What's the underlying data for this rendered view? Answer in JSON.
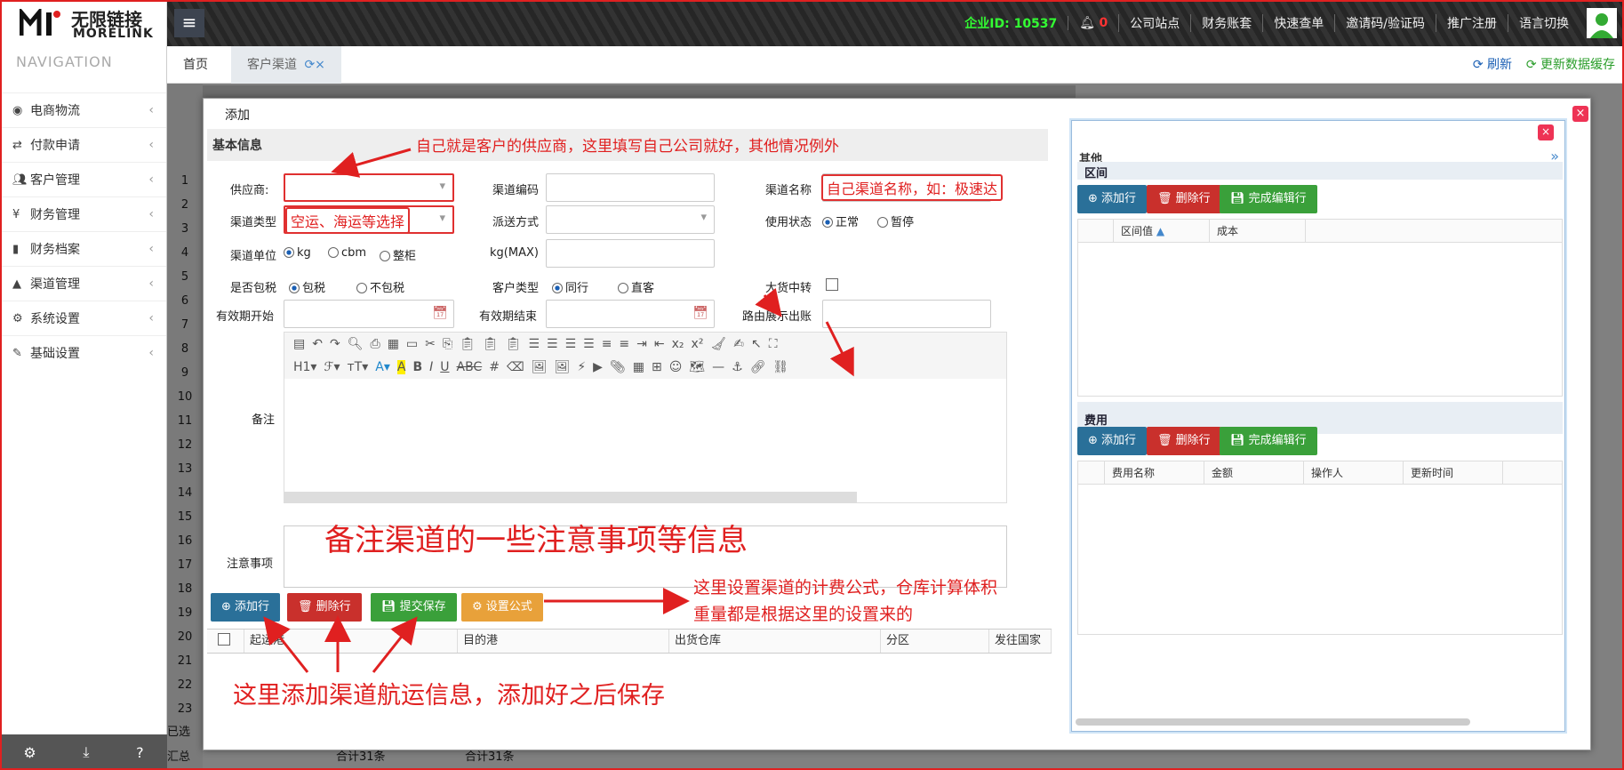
{
  "brand": {
    "name_cn": "无限链接",
    "name_en": "MORELINK"
  },
  "topnav": {
    "company_id_label": "企业ID:",
    "company_id": "10537",
    "notifications": "0",
    "items": [
      "公司站点",
      "财务账套",
      "快速查单",
      "邀请码/验证码",
      "推广注册",
      "语言切换"
    ]
  },
  "sidebar": {
    "title": "NAVIGATION",
    "items": [
      {
        "label": "电商物流",
        "icon": "globe-icon"
      },
      {
        "label": "付款申请",
        "icon": "transfer-icon"
      },
      {
        "label": "客户管理",
        "icon": "users-icon"
      },
      {
        "label": "财务管理",
        "icon": "yen-icon"
      },
      {
        "label": "财务档案",
        "icon": "book-icon"
      },
      {
        "label": "渠道管理",
        "icon": "road-icon"
      },
      {
        "label": "系统设置",
        "icon": "gear-icon"
      },
      {
        "label": "基础设置",
        "icon": "edit-icon"
      }
    ]
  },
  "tabs": {
    "home": "首页",
    "customer_channel": "客户渠道"
  },
  "toolbar_right": {
    "refresh": "刷新",
    "update_cache": "更新数据缓存"
  },
  "background_rows": [
    "1",
    "2",
    "3",
    "4",
    "5",
    "6",
    "7",
    "8",
    "9",
    "10",
    "11",
    "12",
    "13",
    "14",
    "15",
    "16",
    "17",
    "18",
    "19",
    "20",
    "21",
    "22",
    "23"
  ],
  "background_footer": {
    "selected": "已选",
    "summary": "汇总",
    "total1": "合计31条",
    "total2": "合计31条"
  },
  "dialog": {
    "title": "添加",
    "section_basic": "基本信息",
    "fields": {
      "supplier": "供应商:",
      "channel_code": "渠道编码",
      "channel_name": "渠道名称",
      "channel_type": "渠道类型",
      "delivery_method": "派送方式",
      "use_status": "使用状态",
      "use_status_options": [
        "正常",
        "暂停"
      ],
      "channel_unit": "渠道单位",
      "unit_options": [
        "kg",
        "cbm",
        "整柜"
      ],
      "kg_max": "kg(MAX)",
      "tax_included": "是否包税",
      "tax_options": [
        "包税",
        "不包税"
      ],
      "customer_type": "客户类型",
      "customer_type_options": [
        "同行",
        "直客"
      ],
      "bulk_transfer": "大货中转",
      "valid_start": "有效期开始",
      "valid_end": "有效期结束",
      "route_display": "路由展示出账",
      "remark": "备注",
      "notes": "注意事项"
    },
    "buttons": {
      "add_row": "添加行",
      "delete_row": "删除行",
      "submit_save": "提交保存",
      "set_formula": "设置公式"
    },
    "grid_columns": [
      "起运港",
      "目的港",
      "出货仓库",
      "分区",
      "发往国家"
    ]
  },
  "right_panel": {
    "other_title": "其他",
    "section_interval": "区间",
    "section_fee": "费用",
    "buttons": {
      "add_row": "添加行",
      "delete_row": "删除行",
      "finish_edit": "完成编辑行"
    },
    "interval_columns": [
      "区间值",
      "成本"
    ],
    "fee_columns": [
      "费用名称",
      "金额",
      "操作人",
      "更新时间"
    ]
  },
  "annotations": {
    "supplier_note": "自己就是客户的供应商，这里填写自己公司就好，其他情况例外",
    "channel_name_note": "自己渠道名称，如：极速达",
    "channel_type_note": "空运、海运等选择",
    "notes_note": "备注渠道的一些注意事项等信息",
    "formula_note_1": "这里设置渠道的计费公式，仓库计算体积",
    "formula_note_2": "重量都是根据这里的设置来的",
    "save_note": "这里添加渠道航运信息，添加好之后保存"
  },
  "colors": {
    "accent_red": "#e02020",
    "company_id": "#33ff33",
    "btn_blue": "#2a7099",
    "btn_red": "#c9302c",
    "btn_green": "#3aa03a",
    "btn_orange": "#e8a13a"
  }
}
